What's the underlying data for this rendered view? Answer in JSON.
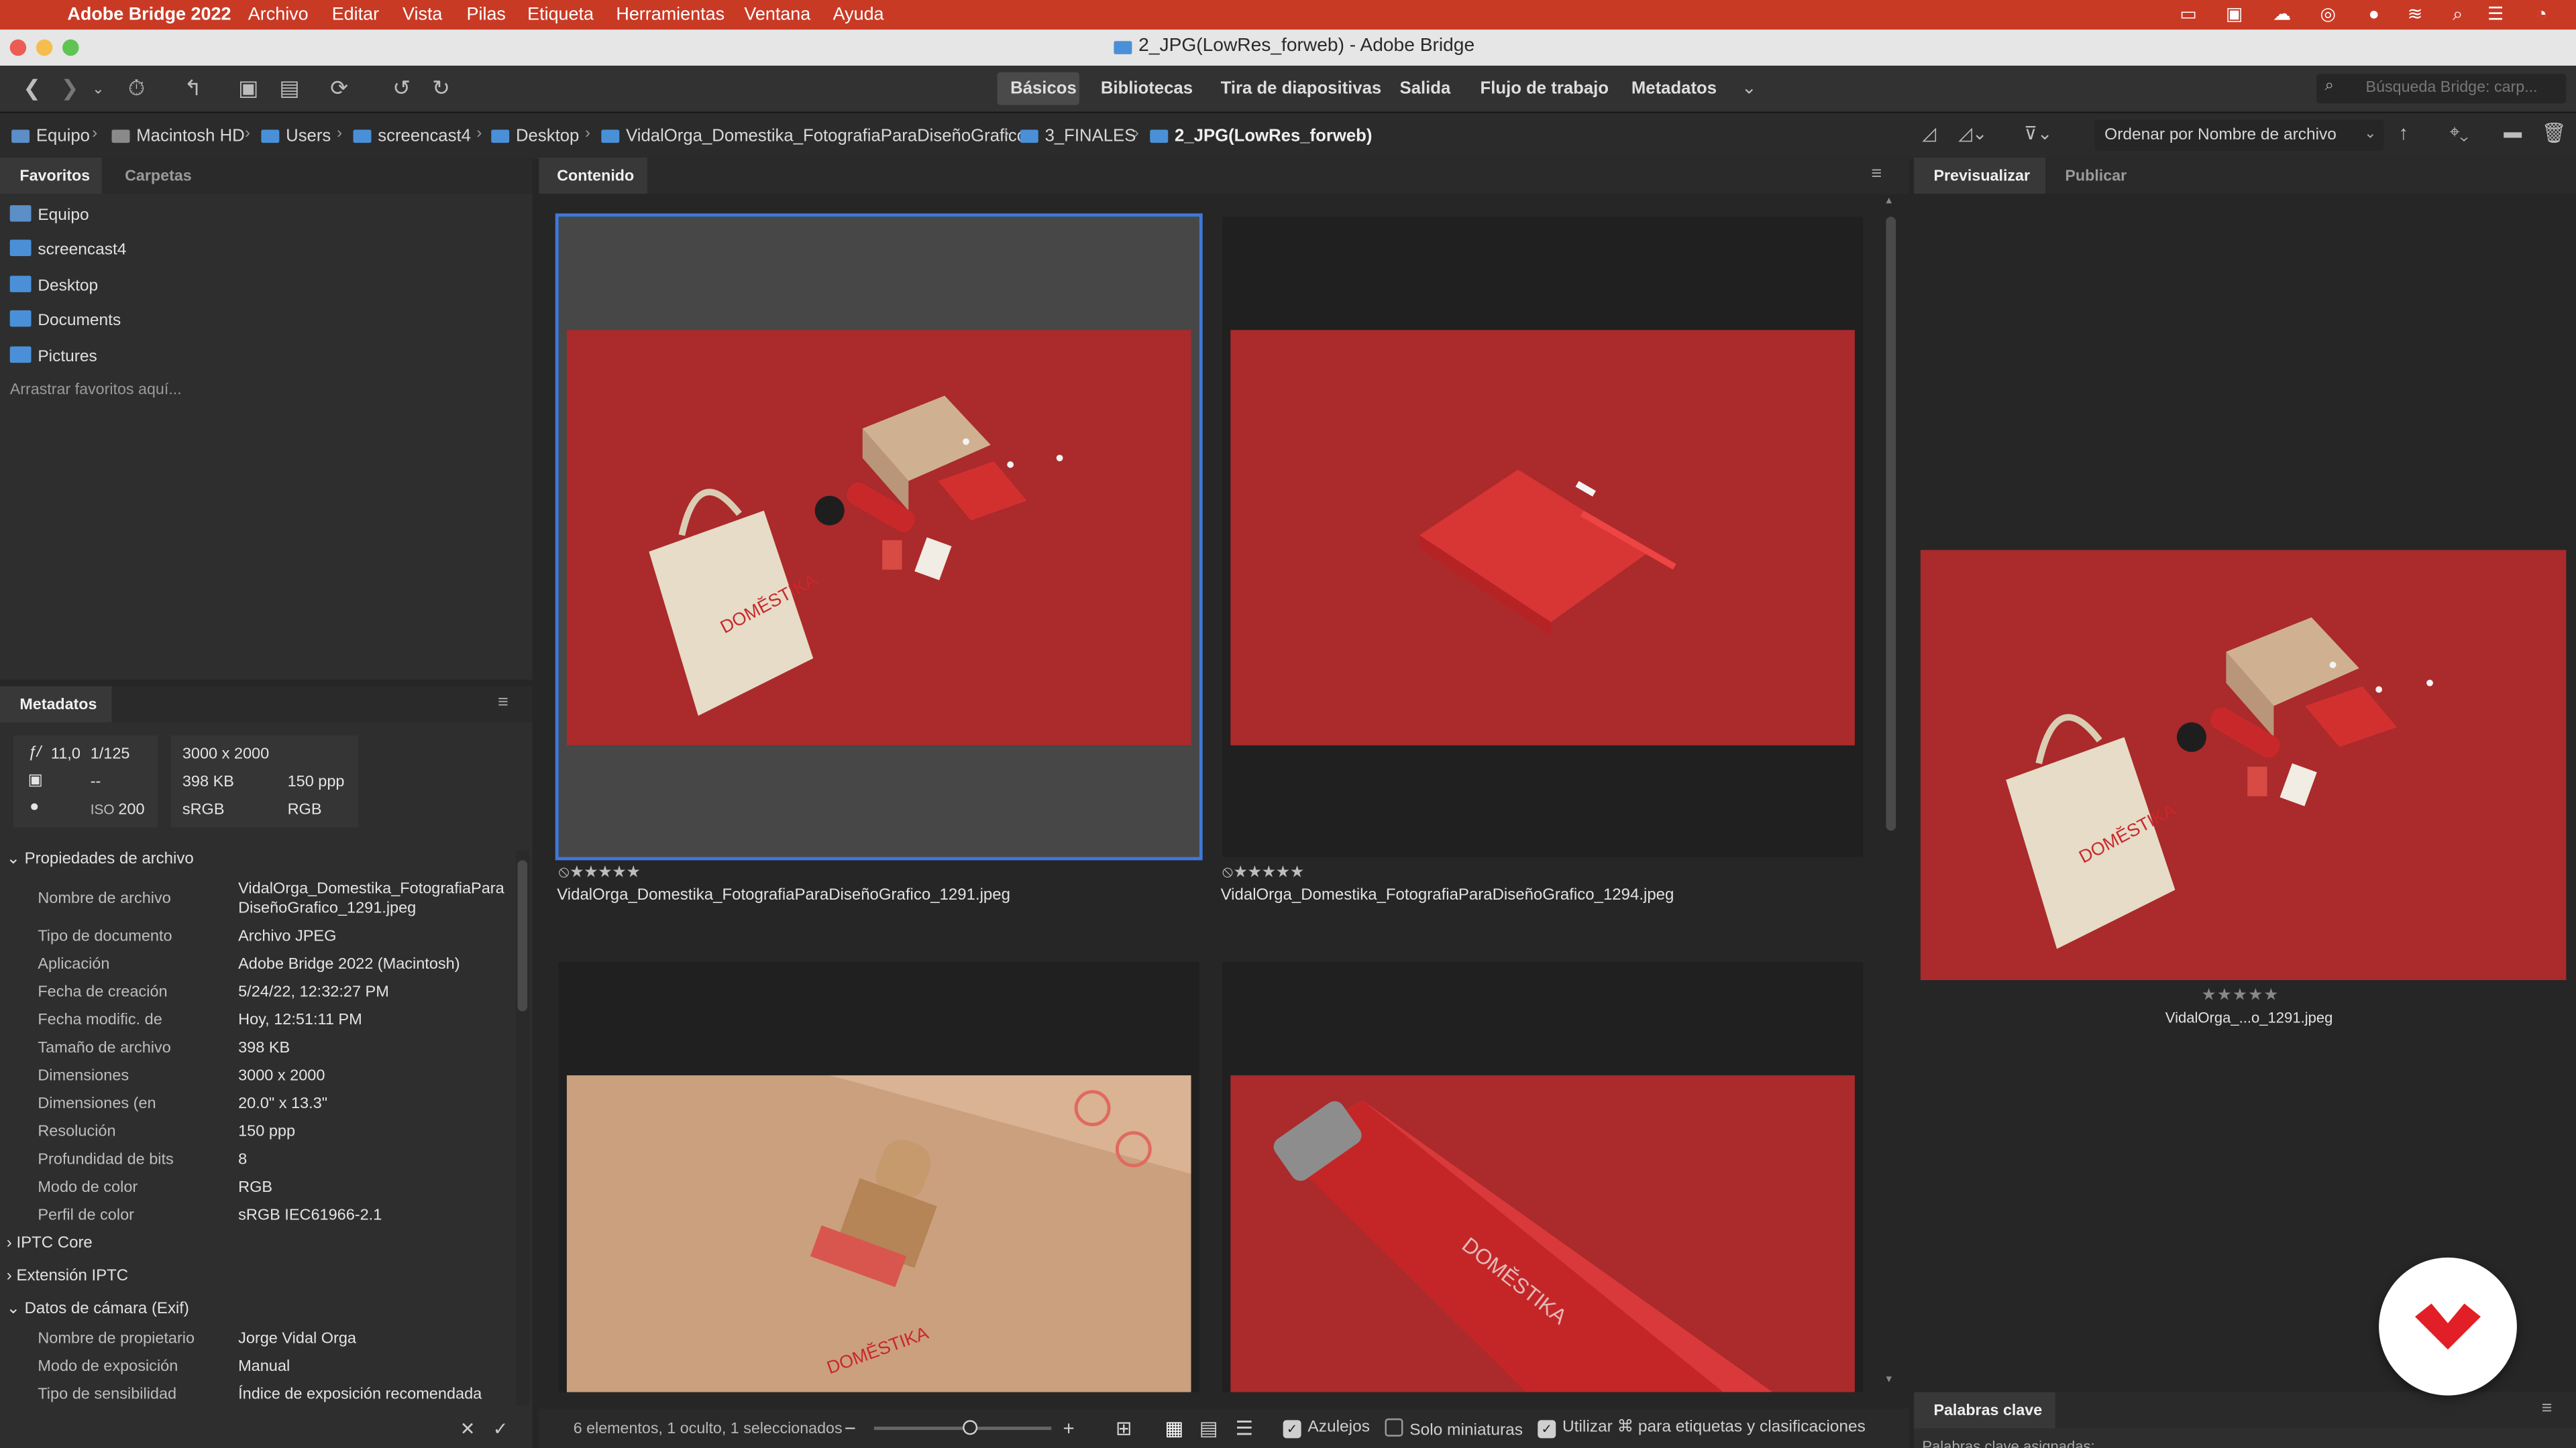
{
  "menubar": {
    "app": "Adobe Bridge 2022",
    "items": [
      "Archivo",
      "Editar",
      "Vista",
      "Pilas",
      "Etiqueta",
      "Herramientas",
      "Ventana",
      "Ayuda"
    ]
  },
  "window": {
    "title": "2_JPG(LowRes_forweb) - Adobe Bridge"
  },
  "workspaces": [
    "Básicos",
    "Bibliotecas",
    "Tira de diapositivas",
    "Salida",
    "Flujo de trabajo",
    "Metadatos"
  ],
  "search": {
    "placeholder": "Búsqueda Bridge: carp..."
  },
  "breadcrumb": [
    "Equipo",
    "Macintosh HD",
    "Users",
    "screencast4",
    "Desktop",
    "VidalOrga_Domestika_FotografiaParaDiseñoGrafico",
    "3_FINALES",
    "2_JPG(LowRes_forweb)"
  ],
  "sort": {
    "label": "Ordenar por Nombre de archivo"
  },
  "left_tabs": {
    "favorites": "Favoritos",
    "folders": "Carpetas"
  },
  "favorites": [
    "Equipo",
    "screencast4",
    "Desktop",
    "Documents",
    "Pictures"
  ],
  "favorites_hint": "Arrastrar favoritos aquí...",
  "metadata_panel": {
    "title": "Metadatos",
    "summary": {
      "aperture": "11,0",
      "shutter": "1/125",
      "dimensions": "3000 x 2000",
      "size": "398 KB",
      "resolution": "150 ppp",
      "wb": "--",
      "iso_label": "ISO",
      "iso": "200",
      "color_profile": "sRGB",
      "color_mode": "RGB"
    },
    "file_props_title": "Propiedades de archivo",
    "file_props": [
      {
        "label": "Nombre de archivo",
        "value": "VidalOrga_Domestika_FotografiaPara\nDiseñoGrafico_1291.jpeg"
      },
      {
        "label": "Tipo de documento",
        "value": "Archivo JPEG"
      },
      {
        "label": "Aplicación",
        "value": "Adobe Bridge 2022 (Macintosh)"
      },
      {
        "label": "Fecha de creación",
        "value": "5/24/22, 12:32:27 PM"
      },
      {
        "label": "Fecha modific. de",
        "value": "Hoy, 12:51:11 PM"
      },
      {
        "label": "Tamaño de archivo",
        "value": "398 KB"
      },
      {
        "label": "Dimensiones",
        "value": "3000 x 2000"
      },
      {
        "label": "Dimensiones (en",
        "value": "20.0\" x 13.3\""
      },
      {
        "label": "Resolución",
        "value": "150 ppp"
      },
      {
        "label": "Profundidad de bits",
        "value": "8"
      },
      {
        "label": "Modo de color",
        "value": "RGB"
      },
      {
        "label": "Perfil de color",
        "value": "sRGB IEC61966-2.1"
      }
    ],
    "sections": [
      "IPTC Core",
      "Extensión IPTC",
      "Datos de cámara (Exif)"
    ],
    "exif": [
      {
        "label": "Nombre de propietario",
        "value": "Jorge Vidal Orga"
      },
      {
        "label": "Modo de exposición",
        "value": "Manual"
      },
      {
        "label": "Tipo de sensibilidad",
        "value": "Índice de exposición recomendada"
      }
    ]
  },
  "content": {
    "tab": "Contenido",
    "thumbnails": [
      {
        "name": "VidalOrga_Domestika_FotografiaParaDiseñoGrafico_1291.jpeg",
        "selected": true
      },
      {
        "name": "VidalOrga_Domestika_FotografiaParaDiseñoGrafico_1294.jpeg",
        "selected": false
      }
    ],
    "status": "6 elementos, 1 oculto, 1 seleccionados",
    "tiles_label": "Azulejos",
    "thumbs_only_label": "Solo miniaturas",
    "cmd_label": "Utilizar ⌘ para etiquetas y clasificaciones",
    "brand_text": "DOMĔSTIKA"
  },
  "preview": {
    "tab_preview": "Previsualizar",
    "tab_publish": "Publicar",
    "caption": "VidalOrga_...o_1291.jpeg",
    "keywords_tab": "Palabras clave",
    "keywords_hint": "Palabras clave asignadas:"
  },
  "colors": {
    "accent": "#c93a25",
    "photo_red": "#ab2a2b",
    "selection": "#3f78d8"
  }
}
